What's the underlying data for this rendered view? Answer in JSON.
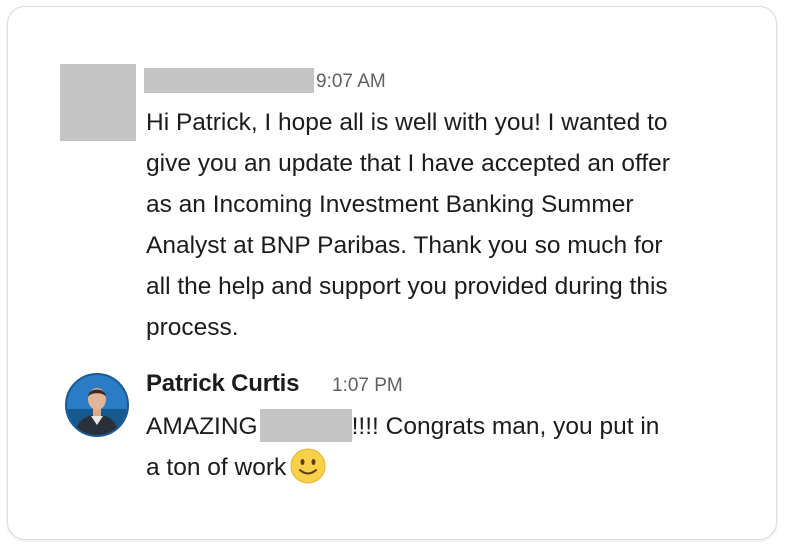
{
  "messages": [
    {
      "sender": "",
      "time": "9:07 AM",
      "lines": [
        "Hi Patrick, I hope all is well with you! I wanted to",
        "give you an update that I have accepted an offer",
        "as an Incoming Investment Banking Summer",
        "Analyst at BNP Paribas. Thank you so much for",
        "all the help and support you provided during this",
        "process."
      ]
    },
    {
      "sender": "Patrick Curtis",
      "time": "1:07 PM",
      "line1_before_redaction": "AMAZING",
      "line1_after_redaction": "!!!!  Congrats man, you put in",
      "line2": "a ton of work",
      "emoji": "slightly-smiling-face"
    }
  ],
  "colors": {
    "text": "#1d1c1d",
    "timestamp": "#616061",
    "redaction": "#c4c4c4",
    "card_border": "#dcdcdc"
  }
}
